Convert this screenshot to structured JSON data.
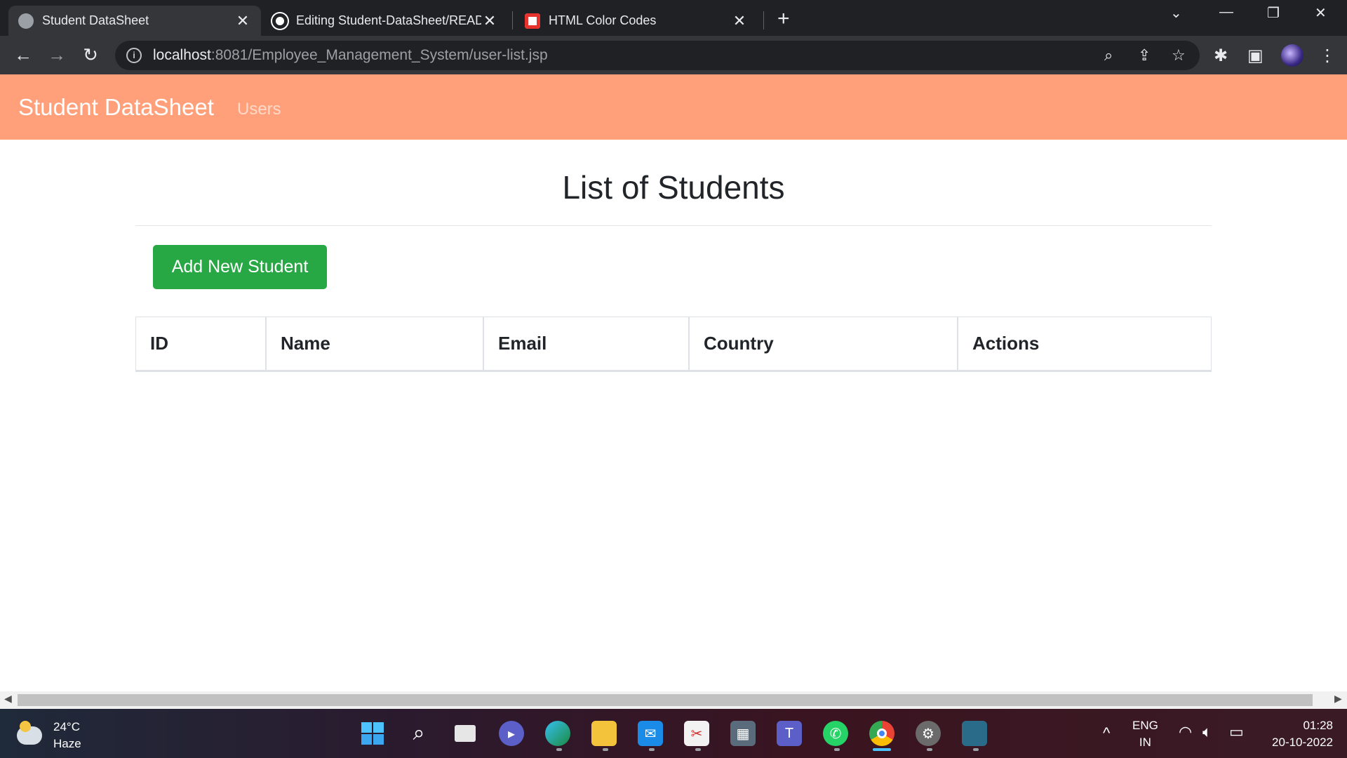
{
  "browser": {
    "tabs": [
      {
        "title": "Student DataSheet",
        "active": true
      },
      {
        "title": "Editing Student-DataSheet/READ",
        "active": false
      },
      {
        "title": "HTML Color Codes",
        "active": false
      }
    ],
    "url_host": "localhost",
    "url_rest": ":8081/Employee_Management_System/user-list.jsp"
  },
  "navbar": {
    "brand": "Student DataSheet",
    "link_users": "Users",
    "color": "#ffa07a"
  },
  "main": {
    "title": "List of Students",
    "add_button": "Add New Student",
    "add_button_color": "#28a745",
    "table": {
      "headers": [
        "ID",
        "Name",
        "Email",
        "Country",
        "Actions"
      ],
      "rows": []
    }
  },
  "taskbar": {
    "temperature": "24°C",
    "condition": "Haze",
    "lang_1": "ENG",
    "lang_2": "IN",
    "time": "01:28",
    "date": "20-10-2022",
    "apps": [
      "start",
      "search",
      "task-view",
      "meet",
      "edge",
      "file-explorer",
      "mail",
      "snipping-tool",
      "calculator",
      "teams",
      "whatsapp",
      "chrome",
      "settings",
      "mysql-workbench"
    ]
  }
}
